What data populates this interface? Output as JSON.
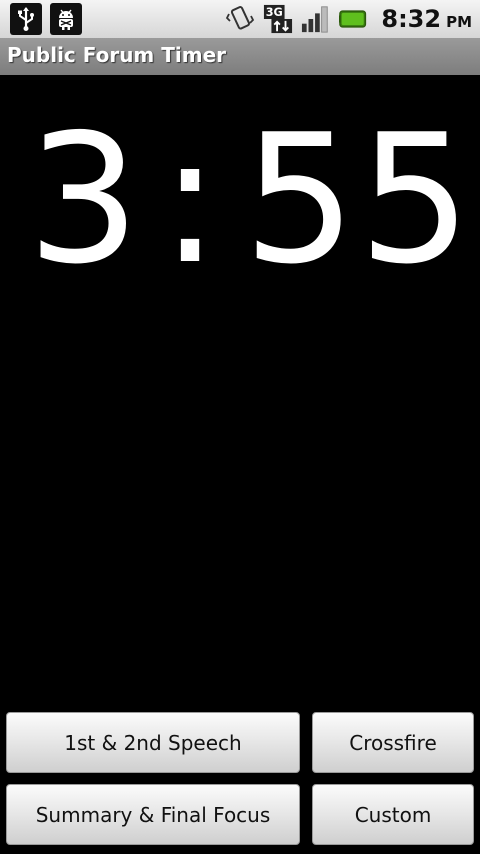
{
  "status_bar": {
    "time": "8:32",
    "ampm": "PM",
    "network_label": "3G",
    "icons": [
      "usb-icon",
      "android-debug-icon",
      "vibrate-icon",
      "3g-data-icon",
      "signal-icon",
      "battery-icon"
    ],
    "battery_color": "#5fbf1e"
  },
  "app": {
    "title": "Public Forum Timer"
  },
  "timer": {
    "minutes": "3",
    "separator": ":",
    "seconds": "55"
  },
  "buttons": {
    "speech": "1st & 2nd Speech",
    "crossfire": "Crossfire",
    "summary": "Summary & Final Focus",
    "custom": "Custom"
  }
}
